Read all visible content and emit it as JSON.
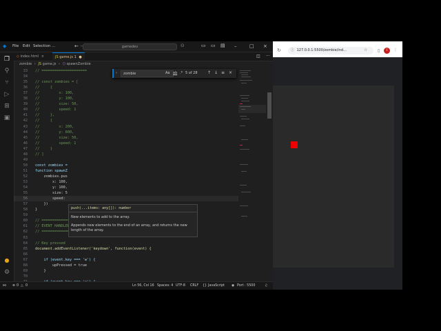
{
  "vscode": {
    "menu": [
      "File",
      "Edit",
      "Selection",
      "..."
    ],
    "command_center": "gamedev",
    "tabs": [
      {
        "label": "index.html",
        "active": false
      },
      {
        "label": "game.js",
        "modified_marker": "1",
        "active": true
      }
    ],
    "breadcrumb": [
      "zombie",
      "game.js",
      "spawnZombie"
    ],
    "find": {
      "query": "zombie",
      "case_label": "Aa",
      "word_label": "ab",
      "regex_label": ".*",
      "count": "5 of 28"
    },
    "code_lines": [
      {
        "n": "33",
        "text": "// ====================="
      },
      {
        "n": "34",
        "text": ""
      },
      {
        "n": "35",
        "text": "// const zombies = ["
      },
      {
        "n": "36",
        "text": "//     {"
      },
      {
        "n": "37",
        "text": "//         x: 100,"
      },
      {
        "n": "38",
        "text": "//         y: 100,"
      },
      {
        "n": "39",
        "text": "//         size: 50,"
      },
      {
        "n": "40",
        "text": "//         speed: 1"
      },
      {
        "n": "41",
        "text": "//     },"
      },
      {
        "n": "42",
        "text": "//     {"
      },
      {
        "n": "43",
        "text": "//         x: 200,"
      },
      {
        "n": "44",
        "text": "//         y: 600,"
      },
      {
        "n": "45",
        "text": "//         size: 50,"
      },
      {
        "n": "46",
        "text": "//         speed: 1"
      },
      {
        "n": "47",
        "text": "//     }"
      },
      {
        "n": "48",
        "text": "// ]"
      },
      {
        "n": "49",
        "text": ""
      },
      {
        "n": "50",
        "text": "const zombies ="
      },
      {
        "n": "51",
        "text": "function spawnZ"
      },
      {
        "n": "52",
        "text": "    zombies.pus"
      },
      {
        "n": "53",
        "text": "        x: 100,"
      },
      {
        "n": "54",
        "text": "        y: 100,"
      },
      {
        "n": "55",
        "text": "        size: 5"
      },
      {
        "n": "56",
        "text": "        speed:"
      },
      {
        "n": "57",
        "text": "    })"
      },
      {
        "n": "58",
        "text": "}"
      },
      {
        "n": "59",
        "text": ""
      },
      {
        "n": "60",
        "text": "// ====================="
      },
      {
        "n": "61",
        "text": "// EVENT HANDLERS"
      },
      {
        "n": "62",
        "text": "// ====================="
      },
      {
        "n": "63",
        "text": ""
      },
      {
        "n": "64",
        "text": "// Key pressed"
      },
      {
        "n": "65",
        "text": "document.addEventListener('keydown', function(event) {"
      },
      {
        "n": "66",
        "text": ""
      },
      {
        "n": "67",
        "text": "    if (event.key === 'w') {"
      },
      {
        "n": "68",
        "text": "        upPressed = true"
      },
      {
        "n": "69",
        "text": "    }"
      },
      {
        "n": "70",
        "text": ""
      },
      {
        "n": "71",
        "text": "    if (event.key === 'a') {"
      }
    ],
    "hover": {
      "signature": "push(...items: any[]): number",
      "param_doc": "New elements to add to the array.",
      "description": "Appends new elements to the end of an array, and returns the new length of the array."
    },
    "status": {
      "errors": "0",
      "warnings": "0",
      "position": "Ln 56, Col 16",
      "spaces": "Spaces: 4",
      "encoding": "UTF-8",
      "eol": "CRLF",
      "language": "JavaScript",
      "port": "Port : 5500"
    }
  },
  "chrome": {
    "url": "127.0.0.1:5500/zombie/ind...",
    "avatar_initial": "I"
  },
  "colors": {
    "zombie": "#ee0000",
    "accent": "#0078d4"
  }
}
